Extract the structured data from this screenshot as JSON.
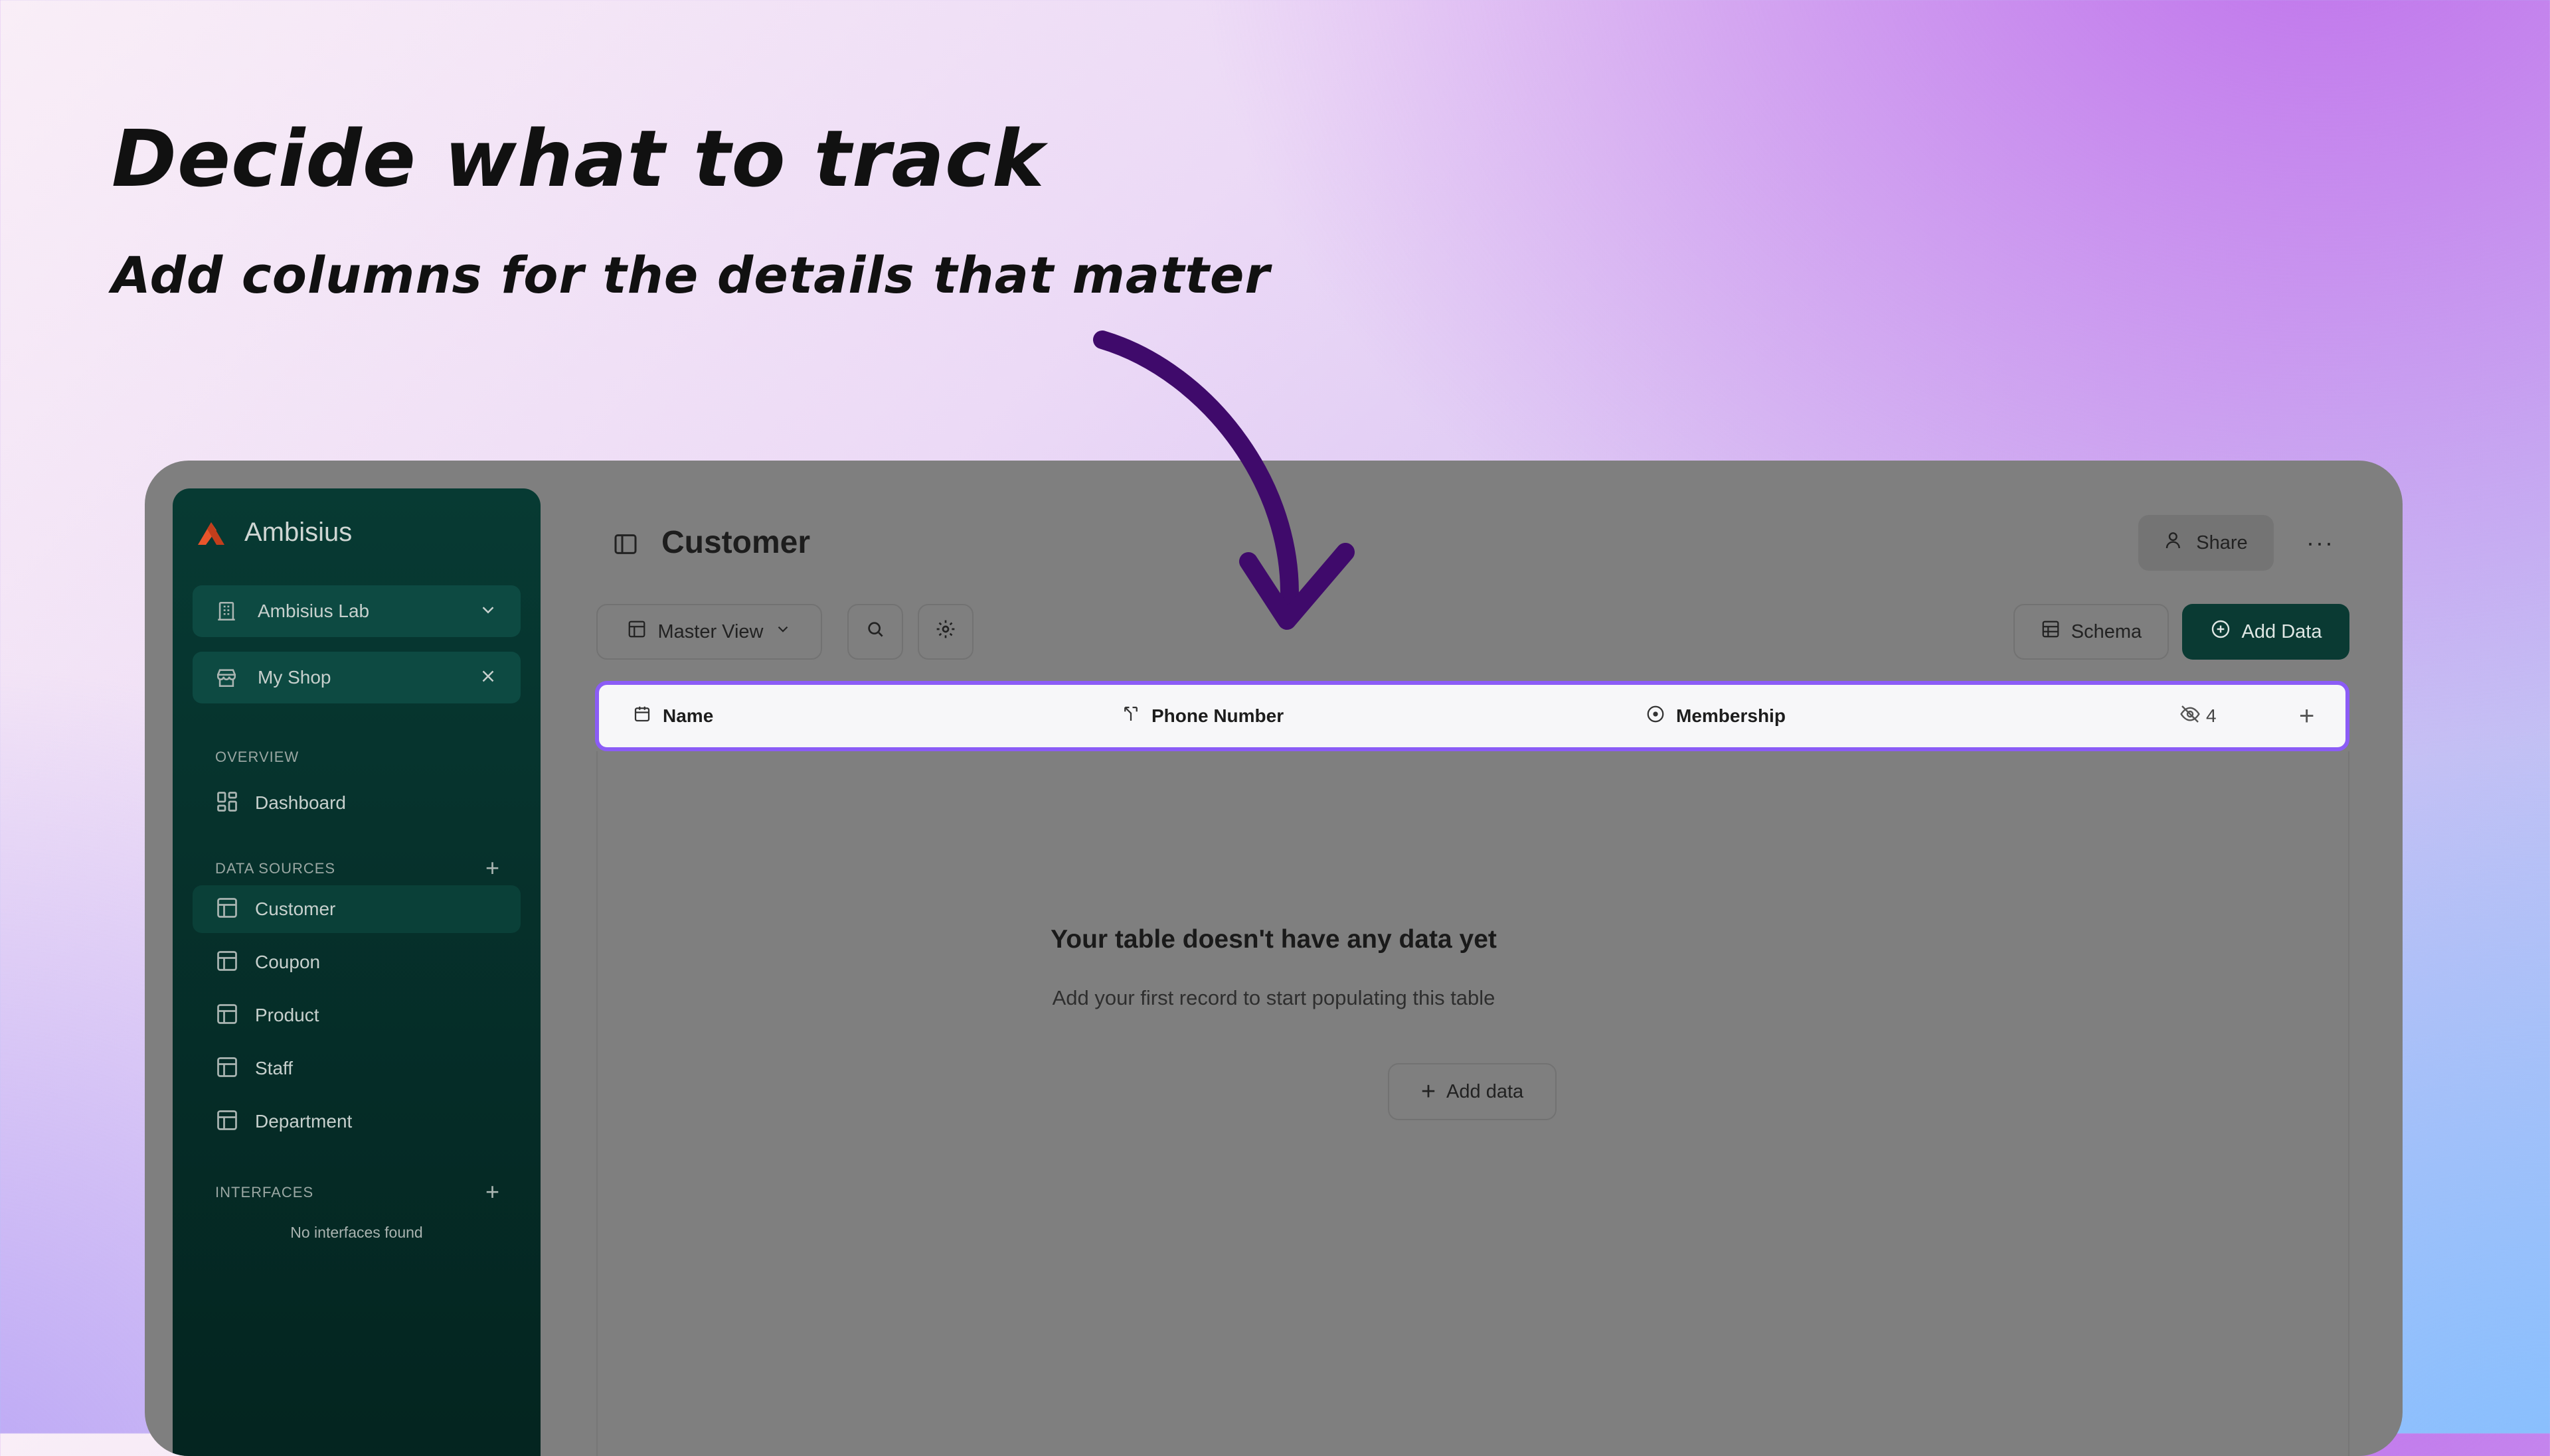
{
  "promo": {
    "headline": "Decide what to track",
    "subheadline": "Add columns for the details that matter",
    "arrow_color": "#3f0a6b"
  },
  "brand": {
    "name": "Ambisius",
    "accent": "#e8552b"
  },
  "sidebar": {
    "workspace": "Ambisius Lab",
    "shop": "My Shop",
    "overview_label": "OVERVIEW",
    "dashboard_label": "Dashboard",
    "data_sources_label": "DATA SOURCES",
    "sources": [
      {
        "label": "Customer",
        "active": true
      },
      {
        "label": "Coupon",
        "active": false
      },
      {
        "label": "Product",
        "active": false
      },
      {
        "label": "Staff",
        "active": false
      },
      {
        "label": "Department",
        "active": false
      }
    ],
    "interfaces_label": "INTERFACES",
    "no_interfaces": "No interfaces found"
  },
  "header": {
    "title": "Customer",
    "share_label": "Share",
    "view_label": "Master View",
    "schema_label": "Schema",
    "add_data_label": "Add Data"
  },
  "table": {
    "columns": [
      {
        "label": "Name",
        "icon": "calendar-icon"
      },
      {
        "label": "Phone Number",
        "icon": "fork-icon"
      },
      {
        "label": "Membership",
        "icon": "circle-dot-icon"
      }
    ],
    "hidden_count": "4"
  },
  "empty_state": {
    "title": "Your table doesn't have any data yet",
    "subtitle": "Add your first record to start populating this table",
    "button_label": "Add data"
  }
}
